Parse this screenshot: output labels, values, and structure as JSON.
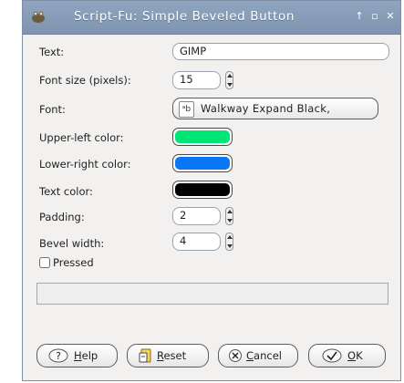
{
  "window": {
    "title": "Script-Fu: Simple Beveled Button"
  },
  "fields": {
    "text": {
      "label": "Text:",
      "value": "GIMP"
    },
    "font_size": {
      "label": "Font size (pixels):",
      "value": "15"
    },
    "font": {
      "label": "Font:",
      "value": "Walkway Expand Black,"
    },
    "upper_left_color": {
      "label": "Upper-left color:",
      "color": "#00e676"
    },
    "lower_right_color": {
      "label": "Lower-right color:",
      "color": "#0a78f5"
    },
    "text_color": {
      "label": "Text color:",
      "color": "#000000"
    },
    "padding": {
      "label": "Padding:",
      "value": "2"
    },
    "bevel_width": {
      "label": "Bevel width:",
      "value": "4"
    },
    "pressed": {
      "label": "Pressed",
      "checked": false
    }
  },
  "progress": {
    "fraction": 0
  },
  "buttons": {
    "help": {
      "mnemonic": "H",
      "rest": "elp"
    },
    "reset": {
      "mnemonic": "R",
      "rest": "eset"
    },
    "cancel": {
      "mnemonic": "C",
      "rest": "ancel"
    },
    "ok": {
      "mnemonic": "O",
      "rest": "K"
    }
  },
  "icons": [
    "gimp-wilber-icon",
    "minimize-icon",
    "maximize-icon",
    "close-icon",
    "font-icon",
    "help-icon",
    "reset-icon",
    "cancel-icon",
    "ok-icon"
  ]
}
